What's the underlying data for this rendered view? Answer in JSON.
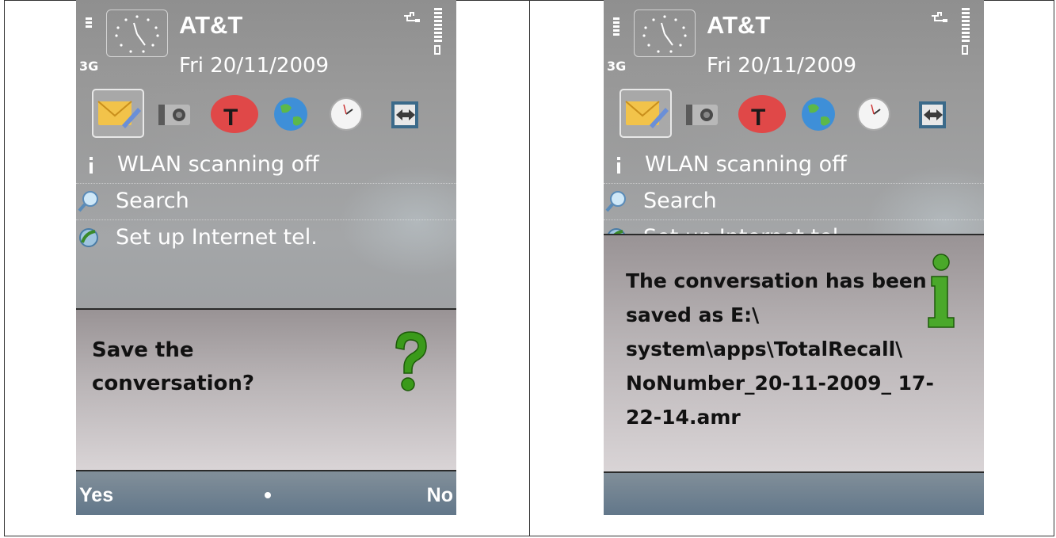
{
  "status_bar": {
    "network_type": "3G",
    "carrier": "AT&T",
    "date": "Fri 20/11/2009"
  },
  "shortcuts": [
    "messaging-icon",
    "camera-icon",
    "t-app-icon",
    "web-globe-icon",
    "clock-icon",
    "transfer-icon"
  ],
  "list_items": {
    "wlan": "WLAN scanning off",
    "search": "Search",
    "internet_tel": "Set up Internet tel."
  },
  "left_screen": {
    "dialog_text": "Save the conversation?",
    "softkey_left": "Yes",
    "softkey_right": "No"
  },
  "right_screen": {
    "dialog_text": "The conversation has been saved as E:\\ system\\apps\\TotalRecall\\ NoNumber_20-11-2009_ 17-22-14.amr"
  },
  "colors": {
    "confirm_icon": "#3a9a1a",
    "info_icon": "#3a9a1a",
    "t_app_bg": "#e04848"
  }
}
